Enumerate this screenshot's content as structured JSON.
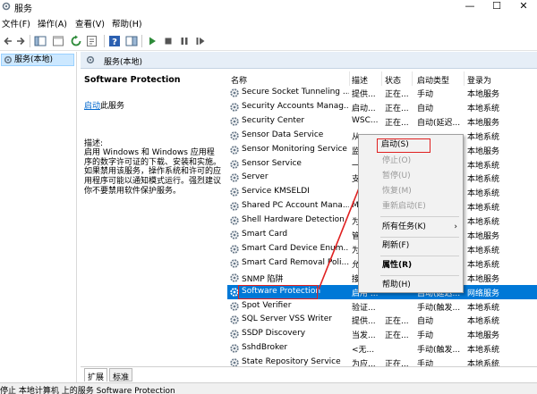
{
  "window": {
    "title": "服务",
    "minimize": "—",
    "maximize": "☐",
    "close": "✕"
  },
  "menu": [
    "文件(F)",
    "操作(A)",
    "查看(V)",
    "帮助(H)"
  ],
  "tree": {
    "root": "服务(本地)"
  },
  "pane": {
    "header": "服务(本地)"
  },
  "description": {
    "service_name": "Software Protection",
    "link": "启动",
    "link_suffix": "此服务",
    "label": "描述:",
    "text": "启用 Windows 和 Windows 应用程序的数字许可证的下载、安装和实施。如果禁用该服务，操作系统和许可的应用程序可能以通知模式运行。强烈建议你不要禁用软件保护服务。"
  },
  "columns": [
    "名称",
    "描述",
    "状态",
    "启动类型",
    "登录为"
  ],
  "rows": [
    {
      "name": "Secure Socket Tunneling ...",
      "desc": "提供...",
      "status": "正在...",
      "startup": "手动",
      "logon": "本地服务"
    },
    {
      "name": "Security Accounts Manag...",
      "desc": "启动...",
      "status": "正在...",
      "startup": "自动",
      "logon": "本地系统"
    },
    {
      "name": "Security Center",
      "desc": "WSC...",
      "status": "正在...",
      "startup": "自动(延迟...",
      "logon": "本地服务"
    },
    {
      "name": "Sensor Data Service",
      "desc": "从",
      "status": "",
      "startup": "",
      "logon": "本地系统"
    },
    {
      "name": "Sensor Monitoring Service",
      "desc": "监",
      "status": "",
      "startup": "",
      "logon": "本地服务"
    },
    {
      "name": "Sensor Service",
      "desc": "一",
      "status": "",
      "startup": "",
      "logon": "本地系统"
    },
    {
      "name": "Server",
      "desc": "支",
      "status": "",
      "startup": "",
      "logon": "本地系统"
    },
    {
      "name": "Service KMSELDI",
      "desc": "",
      "status": "",
      "startup": "",
      "logon": "本地系统"
    },
    {
      "name": "Shared PC Account Mana...",
      "desc": "M",
      "status": "",
      "startup": "",
      "logon": "本地系统"
    },
    {
      "name": "Shell Hardware Detection",
      "desc": "为",
      "status": "",
      "startup": "",
      "logon": "本地系统"
    },
    {
      "name": "Smart Card",
      "desc": "管",
      "status": "",
      "startup": "",
      "logon": "本地服务"
    },
    {
      "name": "Smart Card Device Enum...",
      "desc": "为",
      "status": "",
      "startup": "",
      "logon": "本地系统"
    },
    {
      "name": "Smart Card Removal Poli...",
      "desc": "允",
      "status": "",
      "startup": "",
      "logon": "本地系统"
    },
    {
      "name": "SNMP 陷阱",
      "desc": "接",
      "status": "",
      "startup": "",
      "logon": "本地服务"
    },
    {
      "name": "Software Protection",
      "desc": "启用 ...",
      "status": "",
      "startup": "自动(延迟...",
      "logon": "网络服务"
    },
    {
      "name": "Spot Verifier",
      "desc": "验证...",
      "status": "",
      "startup": "手动(触发...",
      "logon": "本地系统"
    },
    {
      "name": "SQL Server VSS Writer",
      "desc": "提供...",
      "status": "正在...",
      "startup": "自动",
      "logon": "本地系统"
    },
    {
      "name": "SSDP Discovery",
      "desc": "当发...",
      "status": "正在...",
      "startup": "手动",
      "logon": "本地服务"
    },
    {
      "name": "SshdBroker",
      "desc": "<无...",
      "status": "",
      "startup": "手动(触发...",
      "logon": "本地系统"
    },
    {
      "name": "State Repository Service",
      "desc": "为应...",
      "status": "正在...",
      "startup": "手动",
      "logon": "本地系统"
    }
  ],
  "context_menu": {
    "start": "启动(S)",
    "stop": "停止(O)",
    "pause": "暂停(U)",
    "resume": "恢复(M)",
    "restart": "重新启动(E)",
    "all_tasks": "所有任务(K)",
    "refresh": "刷新(F)",
    "properties": "属性(R)",
    "help": "帮助(H)"
  },
  "tabs": [
    "扩展",
    "标准"
  ],
  "status": "停止 本地计算机 上的服务 Software Protection",
  "colors": {
    "selection": "#0078d7",
    "accent_red": "#e02020",
    "header_bg": "#e6eef7",
    "tree_select": "#cce8ff"
  }
}
